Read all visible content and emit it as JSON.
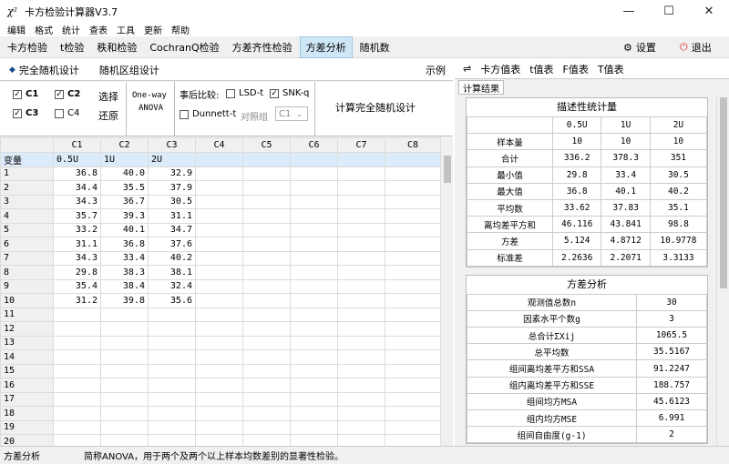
{
  "window": {
    "icon": "χ²",
    "title": "卡方检验计算器V3.7",
    "minimize": "—",
    "maximize": "☐",
    "close": "✕"
  },
  "menu": [
    "编辑",
    "格式",
    "统计",
    "查表",
    "工具",
    "更新",
    "帮助"
  ],
  "tabs": [
    "卡方检验",
    "t检验",
    "秩和检验",
    "CochranQ检验",
    "方差齐性检验",
    "方差分析",
    "随机数"
  ],
  "settings_label": "设置",
  "exit_label": "退出",
  "left": {
    "subtabs": [
      "完全随机设计",
      "随机区组设计"
    ],
    "example": "示例",
    "checks": [
      {
        "label": "C1",
        "checked": true
      },
      {
        "label": "C2",
        "checked": true
      },
      {
        "label": "C3",
        "checked": true
      },
      {
        "label": "C4",
        "checked": false
      }
    ],
    "select_label": "选择",
    "restore_label": "还原",
    "anova_line1": "One-way",
    "anova_line2": "ANOVA",
    "posthoc_label": "事后比较:",
    "lsd": {
      "label": "LSD-t",
      "checked": false
    },
    "snk": {
      "label": "SNK-q",
      "checked": true
    },
    "dunnett": {
      "label": "Dunnett-t",
      "checked": false
    },
    "control_label": "对照组",
    "control_value": "C1",
    "calc_button": "计算完全随机设计"
  },
  "grid": {
    "corner": "",
    "columns": [
      "C1",
      "C2",
      "C3",
      "C4",
      "C5",
      "C6",
      "C7",
      "C8"
    ],
    "var_row": {
      "label": "变量",
      "values": [
        "0.5U",
        "1U",
        "2U",
        "",
        "",
        "",
        "",
        ""
      ]
    },
    "rows": [
      [
        "1",
        "36.8",
        "40.0",
        "32.9"
      ],
      [
        "2",
        "34.4",
        "35.5",
        "37.9"
      ],
      [
        "3",
        "34.3",
        "36.7",
        "30.5"
      ],
      [
        "4",
        "35.7",
        "39.3",
        "31.1"
      ],
      [
        "5",
        "33.2",
        "40.1",
        "34.7"
      ],
      [
        "6",
        "31.1",
        "36.8",
        "37.6"
      ],
      [
        "7",
        "34.3",
        "33.4",
        "40.2"
      ],
      [
        "8",
        "29.8",
        "38.3",
        "38.1"
      ],
      [
        "9",
        "35.4",
        "38.4",
        "32.4"
      ],
      [
        "10",
        "31.2",
        "39.8",
        "35.6"
      ],
      [
        "11"
      ],
      [
        "12"
      ],
      [
        "13"
      ],
      [
        "14"
      ],
      [
        "15"
      ],
      [
        "16"
      ],
      [
        "17"
      ],
      [
        "18"
      ],
      [
        "19"
      ],
      [
        "20"
      ]
    ]
  },
  "right": {
    "swap_icon": "⇌",
    "tabs": [
      "卡方值表",
      "t值表",
      "F值表",
      "T值表"
    ],
    "subtab": "计算结果",
    "desc": {
      "title": "描述性统计量",
      "header": [
        "",
        "0.5U",
        "1U",
        "2U"
      ],
      "rows": [
        [
          "样本量",
          "10",
          "10",
          "10"
        ],
        [
          "合计",
          "336.2",
          "378.3",
          "351"
        ],
        [
          "最小值",
          "29.8",
          "33.4",
          "30.5"
        ],
        [
          "最大值",
          "36.8",
          "40.1",
          "40.2"
        ],
        [
          "平均数",
          "33.62",
          "37.83",
          "35.1"
        ],
        [
          "离均差平方和",
          "46.116",
          "43.841",
          "98.8"
        ],
        [
          "方差",
          "5.124",
          "4.8712",
          "10.9778"
        ],
        [
          "标准差",
          "2.2636",
          "2.2071",
          "3.3133"
        ]
      ]
    },
    "anova": {
      "title": "方差分析",
      "rows": [
        [
          "观测值总数n",
          "30"
        ],
        [
          "因素水平个数g",
          "3"
        ],
        [
          "总合计ΣXij",
          "1065.5"
        ],
        [
          "总平均数",
          "35.5167"
        ],
        [
          "组间离均差平方和SSA",
          "91.2247"
        ],
        [
          "组内离均差平方和SSE",
          "188.757"
        ],
        [
          "组间均方MSA",
          "45.6123"
        ],
        [
          "组内均方MSE",
          "6.991"
        ],
        [
          "组间自由度(g-1)",
          "2"
        ]
      ]
    }
  },
  "status": {
    "left": "方差分析",
    "text": "简称ANOVA，用于两个及两个以上样本均数差别的显著性检验。"
  }
}
